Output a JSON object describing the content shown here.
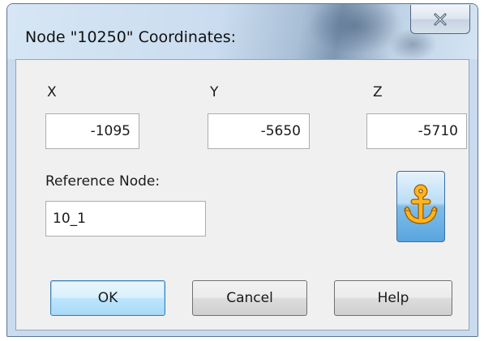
{
  "dialog": {
    "title": "Node \"10250\" Coordinates:",
    "close_glyph": "✕"
  },
  "coords": {
    "x_label": "X",
    "y_label": "Y",
    "z_label": "Z",
    "x_value": "-1095",
    "y_value": "-5650",
    "z_value": "-5710"
  },
  "reference": {
    "label": "Reference Node:",
    "value": "10_1",
    "icon": "anchor-icon"
  },
  "buttons": {
    "ok": "OK",
    "cancel": "Cancel",
    "help": "Help"
  },
  "colors": {
    "titlebar": "#cadcef",
    "client": "#f0f0f0",
    "anchor_fill": "#f5a623",
    "default_button_border": "#3c7fb1"
  }
}
